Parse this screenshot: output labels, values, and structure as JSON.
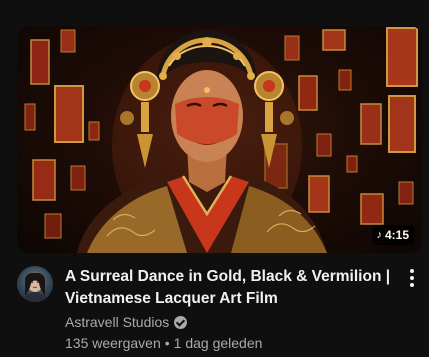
{
  "video": {
    "title_line1": "A Surreal Dance in Gold, Black & Vermilion |",
    "title_line2": "Vietnamese Lacquer Art Film",
    "duration": "4:15",
    "duration_icon": "music-note-icon",
    "channel": "Astravell Studios",
    "channel_badge": "verified-icon",
    "views": "135 weergaven",
    "separator": "•",
    "age": "1 dag geleden",
    "menu_icon": "more-vertical-icon"
  },
  "colors": {
    "background": "#0f0f0f",
    "title": "#f1f1f1",
    "secondary_text": "#aaaaaa",
    "accent_vermilion": "#c8361c",
    "accent_gold": "#d9a440"
  }
}
